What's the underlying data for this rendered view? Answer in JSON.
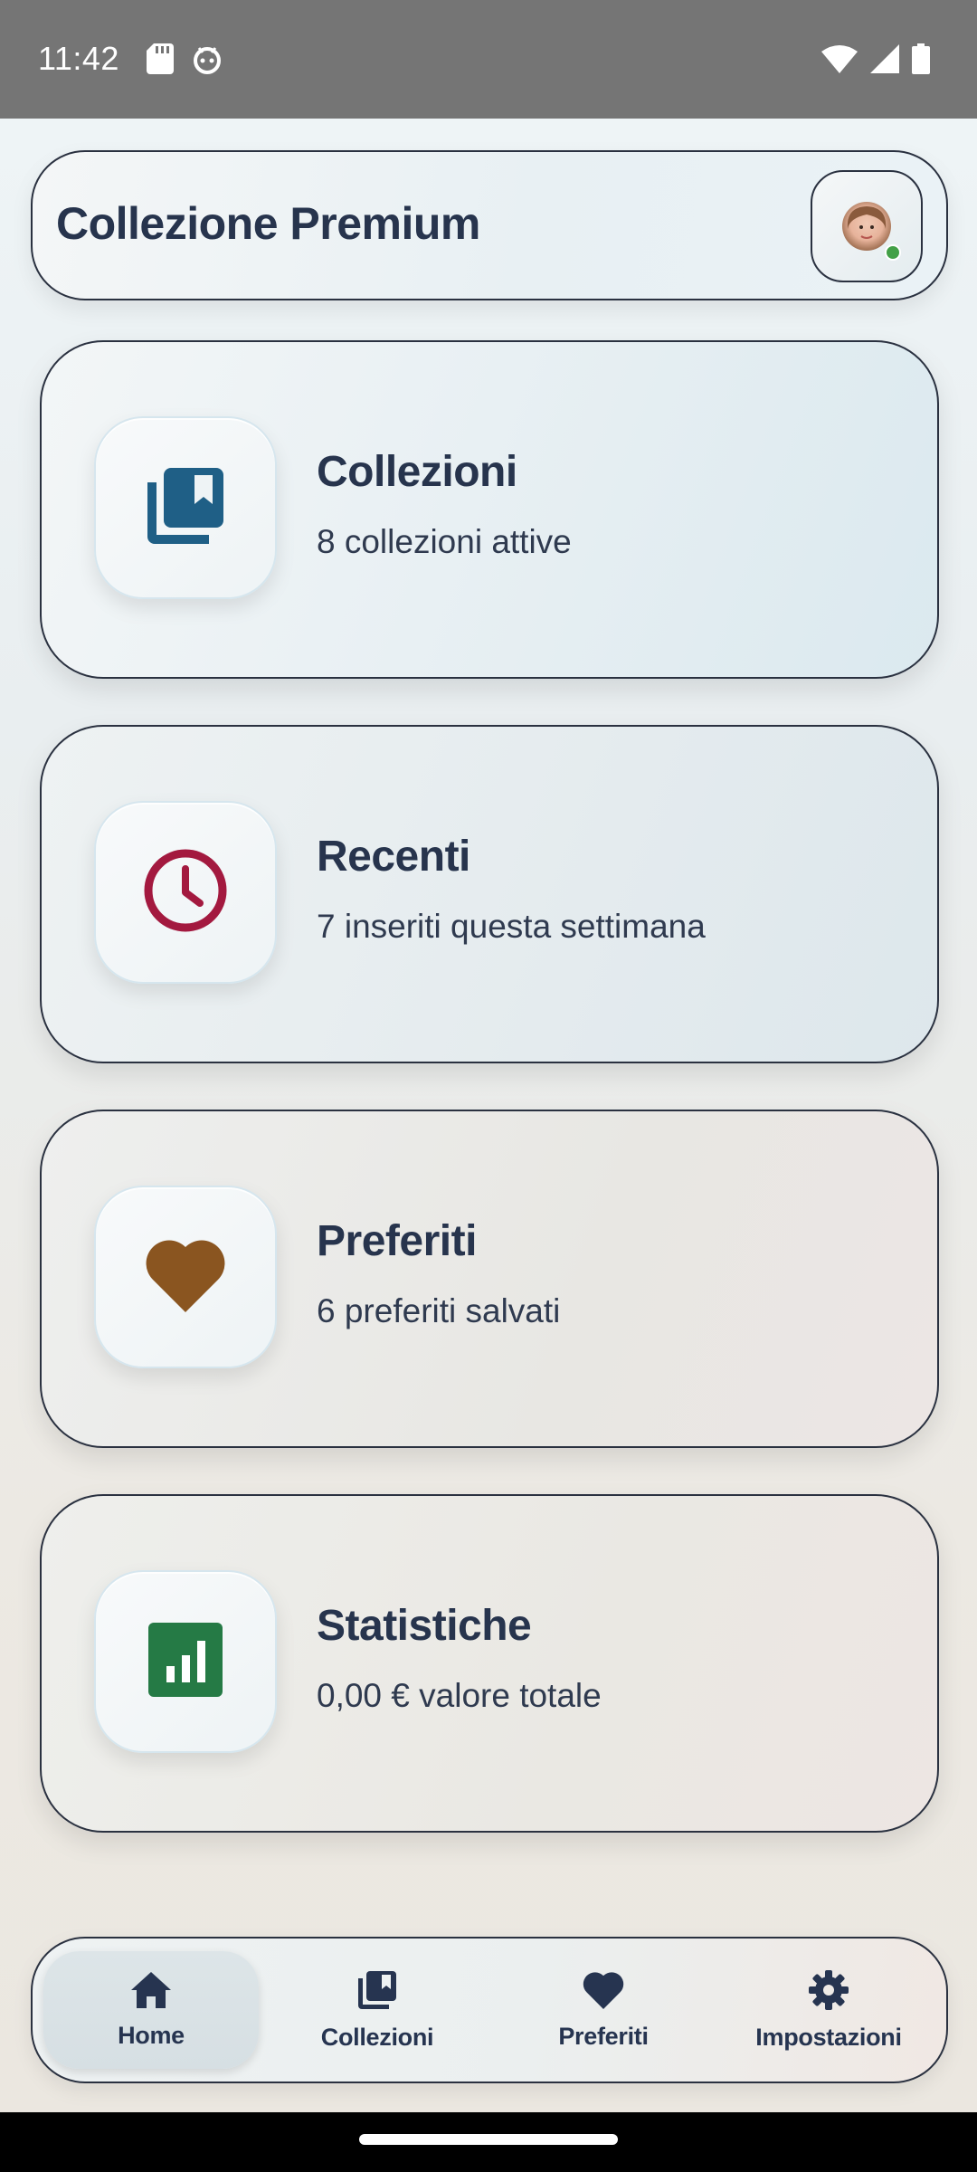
{
  "status_bar": {
    "time": "11:42",
    "icons_left": [
      "sd-card-icon",
      "android-debug-icon"
    ],
    "icons_right": [
      "wifi-icon",
      "signal-icon",
      "battery-icon"
    ]
  },
  "header": {
    "title": "Collezione Premium",
    "avatar_online": true
  },
  "cards": [
    {
      "title": "Collezioni",
      "subtitle": "8 collezioni attive",
      "icon": "collections-icon",
      "icon_color": "#1f5f86"
    },
    {
      "title": "Recenti",
      "subtitle": "7 inseriti questa settimana",
      "icon": "clock-icon",
      "icon_color": "#a3193f"
    },
    {
      "title": "Preferiti",
      "subtitle": "6 preferiti salvati",
      "icon": "heart-icon",
      "icon_color": "#8a5520"
    },
    {
      "title": "Statistiche",
      "subtitle": "0,00 € valore totale",
      "icon": "chart-icon",
      "icon_color": "#257a45"
    }
  ],
  "nav": {
    "items": [
      {
        "label": "Home",
        "icon": "home-icon",
        "active": true
      },
      {
        "label": "Collezioni",
        "icon": "collections-icon",
        "active": false
      },
      {
        "label": "Preferiti",
        "icon": "heart-icon",
        "active": false
      },
      {
        "label": "Impostazioni",
        "icon": "gear-icon",
        "active": false
      }
    ]
  },
  "colors": {
    "text_primary": "#27344d",
    "nav_icon": "#263450",
    "online_dot": "#43a047"
  }
}
